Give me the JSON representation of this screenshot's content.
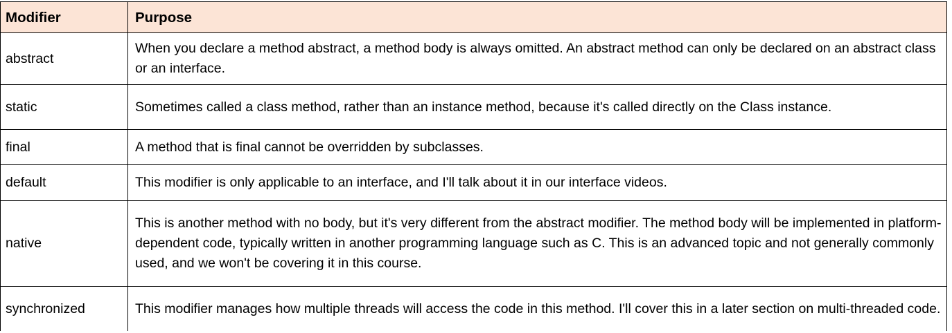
{
  "table": {
    "headers": {
      "modifier": "Modifier",
      "purpose": "Purpose"
    },
    "rows": [
      {
        "modifier": "abstract",
        "purpose": "When you declare a method abstract, a method body is always omitted. An abstract method can only be declared on an abstract class or an interface."
      },
      {
        "modifier": "static",
        "purpose": "Sometimes called a class method, rather than an instance method, because it's called directly on the Class instance."
      },
      {
        "modifier": "final",
        "purpose": "A method that is final cannot be overridden by subclasses."
      },
      {
        "modifier": "default",
        "purpose": "This modifier is only applicable to an interface, and I'll talk about it in our interface videos."
      },
      {
        "modifier": "native",
        "purpose": "This is another method with no body, but it's very different from the abstract modifier.  The method body will be implemented in platform-dependent code, typically written in another programming language such as C.  This is an advanced topic and not generally commonly used, and we won't be covering it in this course."
      },
      {
        "modifier": "synchronized",
        "purpose": "This modifier manages how multiple threads will access the code in this method.  I'll cover this in a later section on multi-threaded code."
      }
    ],
    "colors": {
      "header_background": "#fce4d6",
      "border": "#000000"
    }
  }
}
